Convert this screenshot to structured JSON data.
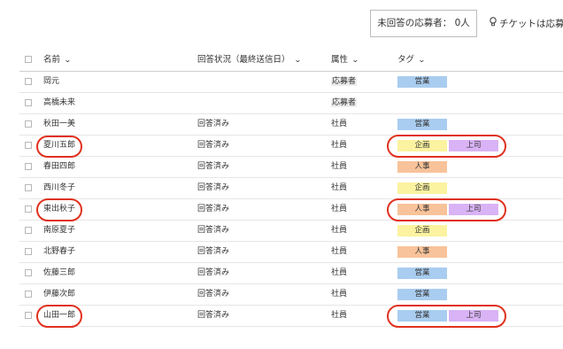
{
  "toolbar": {
    "unanswered_label": "未回答の応募者： 0人",
    "ticket_label": "チケットは応募",
    "ticket_icon": "lightbulb-icon"
  },
  "table": {
    "headers": {
      "name": "名前",
      "status": "回答状況（最終送信日）",
      "attribute": "属性",
      "tags": "タグ"
    },
    "rows": [
      {
        "name": "岡元",
        "status": "",
        "attribute": "応募者",
        "tags": [
          "営業"
        ]
      },
      {
        "name": "高橋未来",
        "status": "",
        "attribute": "応募者",
        "tags": []
      },
      {
        "name": "秋田一美",
        "status": "回答済み",
        "attribute": "社員",
        "tags": [
          "営業"
        ]
      },
      {
        "name": "夏川五郎",
        "status": "回答済み",
        "attribute": "社員",
        "tags": [
          "企画",
          "上司"
        ]
      },
      {
        "name": "春田四郎",
        "status": "回答済み",
        "attribute": "社員",
        "tags": [
          "人事"
        ]
      },
      {
        "name": "西川冬子",
        "status": "回答済み",
        "attribute": "社員",
        "tags": [
          "企画"
        ]
      },
      {
        "name": "東出秋子",
        "status": "回答済み",
        "attribute": "社員",
        "tags": [
          "人事",
          "上司"
        ]
      },
      {
        "name": "南原夏子",
        "status": "回答済み",
        "attribute": "社員",
        "tags": [
          "企画"
        ]
      },
      {
        "name": "北野春子",
        "status": "回答済み",
        "attribute": "社員",
        "tags": [
          "人事"
        ]
      },
      {
        "name": "佐藤三郎",
        "status": "回答済み",
        "attribute": "社員",
        "tags": [
          "営業"
        ]
      },
      {
        "name": "伊藤次郎",
        "status": "回答済み",
        "attribute": "社員",
        "tags": [
          "営業"
        ]
      },
      {
        "name": "山田一郎",
        "status": "回答済み",
        "attribute": "社員",
        "tags": [
          "営業",
          "上司"
        ]
      }
    ]
  },
  "tag_colors": {
    "営業": "#a9cdf0",
    "企画": "#fbf3a0",
    "人事": "#f8c39a",
    "上司": "#d9b3f5"
  },
  "highlight_color": "#e0311f"
}
